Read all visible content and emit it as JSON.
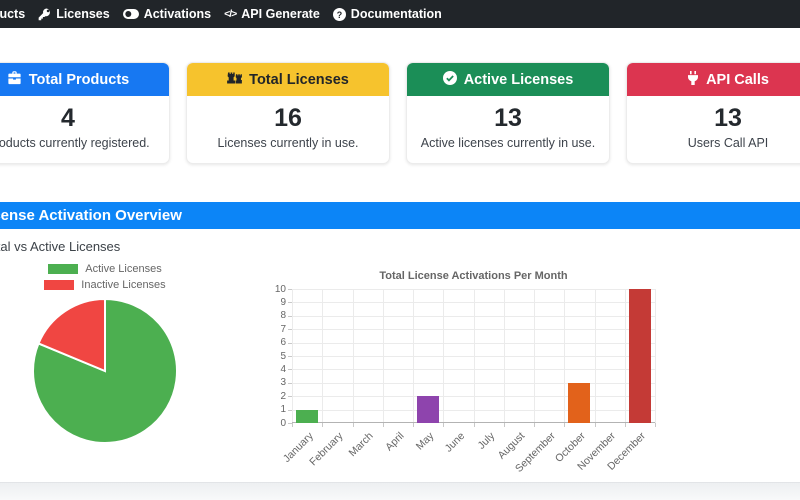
{
  "navbar": {
    "bg_color": "#212529",
    "items": [
      {
        "label": "Products",
        "icon": "box-icon"
      },
      {
        "label": "Licenses",
        "icon": "key-icon"
      },
      {
        "label": "Activations",
        "icon": "toggle-icon"
      },
      {
        "label": "API Generate",
        "icon": "code-icon"
      },
      {
        "label": "Documentation",
        "icon": "question-circle-icon"
      }
    ]
  },
  "stat_cards": [
    {
      "title": "Total Products",
      "value": "4",
      "subtitle": "Products currently registered.",
      "icon": "briefcase-icon",
      "header_color": "#1778f2",
      "header_text_color": "#ffffff"
    },
    {
      "title": "Total Licenses",
      "value": "16",
      "subtitle": "Licenses currently in use.",
      "icon": "licenses-icon",
      "header_color": "#f6c32d",
      "header_text_color": "#212529"
    },
    {
      "title": "Active Licenses",
      "value": "13",
      "subtitle": "Active licenses currently in use.",
      "icon": "check-circle-icon",
      "header_color": "#1b8e57",
      "header_text_color": "#ffffff"
    },
    {
      "title": "API Calls",
      "value": "13",
      "subtitle": "Users Call API",
      "icon": "plug-icon",
      "header_color": "#dc3550",
      "header_text_color": "#ffffff"
    }
  ],
  "section": {
    "banner_title": "License Activation Overview",
    "banner_color": "#0c85f7",
    "subtitle": "Total vs Active Licenses"
  },
  "chart_data": [
    {
      "type": "pie",
      "title": "",
      "legend_position": "top",
      "labels": [
        "Active Licenses",
        "Inactive Licenses"
      ],
      "values": [
        13,
        3
      ],
      "colors": [
        "#4caf50",
        "#f04642"
      ]
    },
    {
      "type": "bar",
      "title": "Total License Activations Per Month",
      "categories": [
        "January",
        "February",
        "March",
        "April",
        "May",
        "June",
        "July",
        "August",
        "September",
        "October",
        "November",
        "December"
      ],
      "values": [
        1,
        0,
        0,
        0,
        2,
        0,
        0,
        0,
        0,
        3,
        0,
        10
      ],
      "colors": [
        "#4caf50",
        null,
        null,
        null,
        "#8e44ad",
        null,
        null,
        null,
        null,
        "#e2621b",
        null,
        "#c43a36"
      ],
      "xlabel": "",
      "ylabel": "",
      "ylim": [
        0,
        10
      ],
      "y_step": 1,
      "grid": true,
      "legend": false
    }
  ]
}
